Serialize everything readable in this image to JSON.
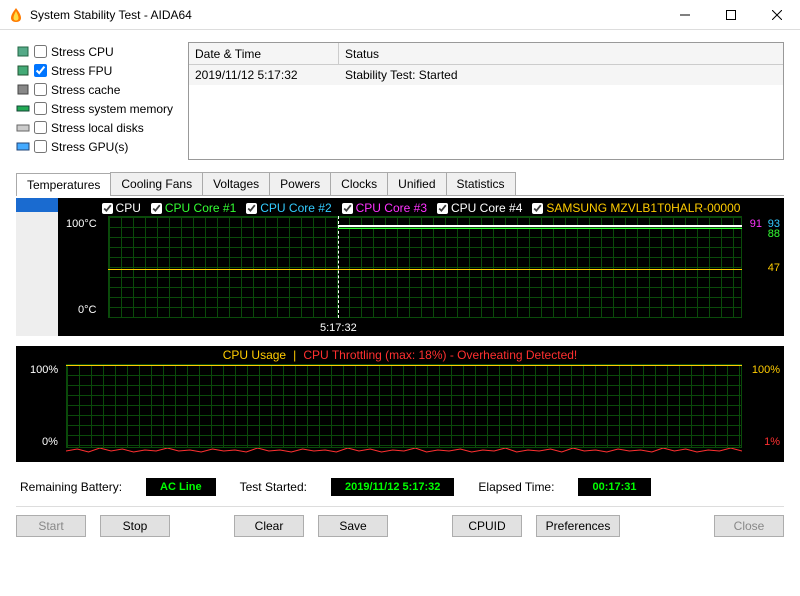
{
  "window": {
    "title": "System Stability Test - AIDA64"
  },
  "stress": {
    "items": [
      {
        "label": "Stress CPU",
        "checked": false
      },
      {
        "label": "Stress FPU",
        "checked": true
      },
      {
        "label": "Stress cache",
        "checked": false
      },
      {
        "label": "Stress system memory",
        "checked": false
      },
      {
        "label": "Stress local disks",
        "checked": false
      },
      {
        "label": "Stress GPU(s)",
        "checked": false
      }
    ]
  },
  "log": {
    "headers": {
      "datetime": "Date & Time",
      "status": "Status"
    },
    "rows": [
      {
        "datetime": "2019/11/12 5:17:32",
        "status": "Stability Test: Started"
      }
    ]
  },
  "tabs": [
    "Temperatures",
    "Cooling Fans",
    "Voltages",
    "Powers",
    "Clocks",
    "Unified",
    "Statistics"
  ],
  "active_tab": 0,
  "temp_chart": {
    "legend": [
      {
        "label": "CPU",
        "color": "#ffffff",
        "checked": true
      },
      {
        "label": "CPU Core #1",
        "color": "#33ff33",
        "checked": true
      },
      {
        "label": "CPU Core #2",
        "color": "#33ccff",
        "checked": true
      },
      {
        "label": "CPU Core #3",
        "color": "#ff33ff",
        "checked": true
      },
      {
        "label": "CPU Core #4",
        "color": "#ffffff",
        "checked": true
      },
      {
        "label": "SAMSUNG MZVLB1T0HALR-00000",
        "color": "#ffcc00",
        "checked": true
      }
    ],
    "y_max": "100°C",
    "y_min": "0°C",
    "marker_time": "5:17:32",
    "readings": [
      {
        "value": "93",
        "color": "#33ccff"
      },
      {
        "value": "91",
        "color": "#ff33ff"
      },
      {
        "value": "88",
        "color": "#33ff33"
      },
      {
        "value": "47",
        "color": "#ffcc00"
      }
    ]
  },
  "usage_chart": {
    "title_usage": "CPU Usage",
    "title_throttle": "CPU Throttling (max: 18%) - Overheating Detected!",
    "y_max": "100%",
    "y_min": "0%",
    "r_max": "100%",
    "r_min": "1%"
  },
  "status": {
    "battery_label": "Remaining Battery:",
    "battery_value": "AC Line",
    "started_label": "Test Started:",
    "started_value": "2019/11/12 5:17:32",
    "elapsed_label": "Elapsed Time:",
    "elapsed_value": "00:17:31"
  },
  "buttons": {
    "start": "Start",
    "stop": "Stop",
    "clear": "Clear",
    "save": "Save",
    "cpuid": "CPUID",
    "prefs": "Preferences",
    "close": "Close"
  },
  "chart_data": [
    {
      "type": "line",
      "title": "Temperatures",
      "ylabel": "°C",
      "ylim": [
        0,
        100
      ],
      "x_marker": "5:17:32",
      "series": [
        {
          "name": "CPU",
          "approx_value_after_marker": 92
        },
        {
          "name": "CPU Core #1",
          "approx_value_after_marker": 88
        },
        {
          "name": "CPU Core #2",
          "approx_value_after_marker": 93
        },
        {
          "name": "CPU Core #3",
          "approx_value_after_marker": 91
        },
        {
          "name": "CPU Core #4",
          "approx_value_after_marker": 90
        },
        {
          "name": "SAMSUNG MZVLB1T0HALR-00000",
          "approx_value_after_marker": 47
        }
      ]
    },
    {
      "type": "line",
      "title": "CPU Usage / Throttling",
      "ylabel": "%",
      "ylim": [
        0,
        100
      ],
      "series": [
        {
          "name": "CPU Usage",
          "approx_value": 100
        },
        {
          "name": "CPU Throttling",
          "approx_value": 1,
          "max": 18
        }
      ]
    }
  ]
}
